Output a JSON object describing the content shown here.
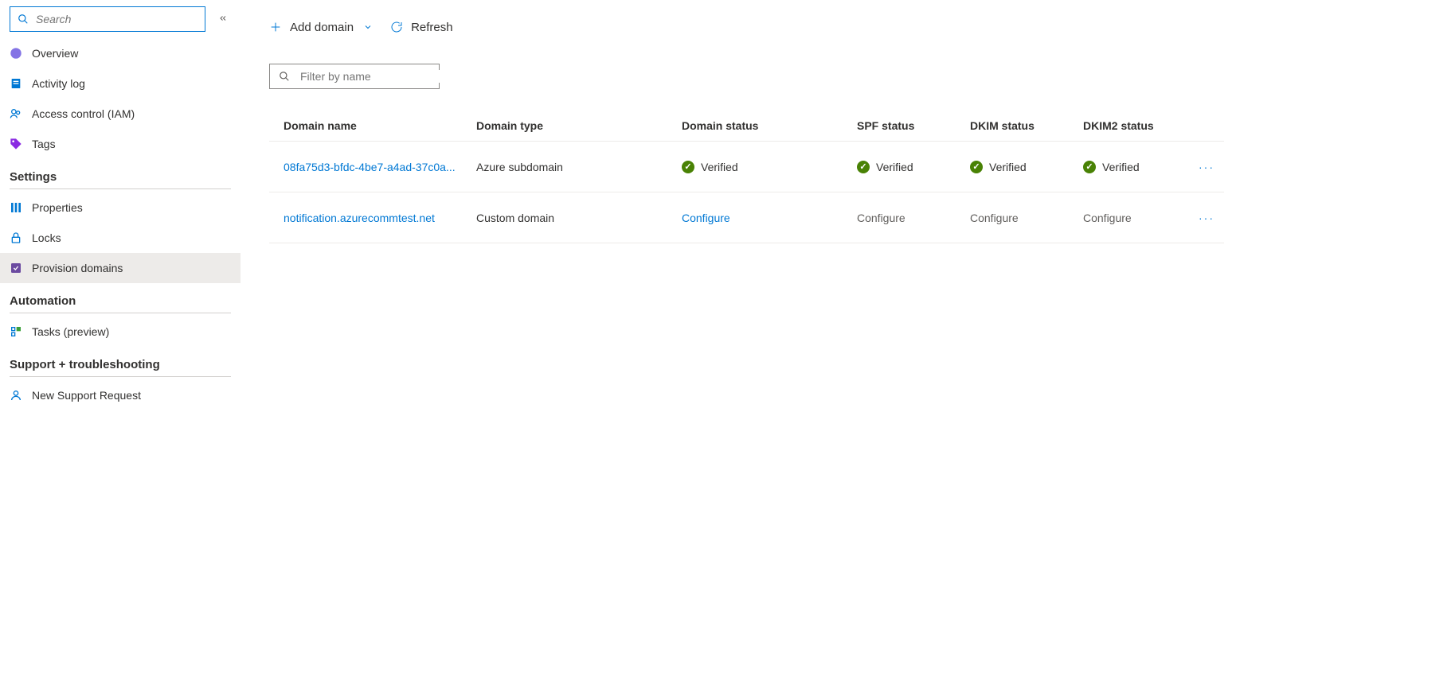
{
  "sidebar": {
    "search_placeholder": "Search",
    "items_top": [
      {
        "label": "Overview",
        "icon": "overview"
      },
      {
        "label": "Activity log",
        "icon": "activity"
      },
      {
        "label": "Access control (IAM)",
        "icon": "iam"
      },
      {
        "label": "Tags",
        "icon": "tags"
      }
    ],
    "sections": [
      {
        "title": "Settings",
        "items": [
          {
            "label": "Properties",
            "icon": "properties"
          },
          {
            "label": "Locks",
            "icon": "locks"
          },
          {
            "label": "Provision domains",
            "icon": "provision",
            "selected": true
          }
        ]
      },
      {
        "title": "Automation",
        "items": [
          {
            "label": "Tasks (preview)",
            "icon": "tasks"
          }
        ]
      },
      {
        "title": "Support + troubleshooting",
        "items": [
          {
            "label": "New Support Request",
            "icon": "support"
          }
        ]
      }
    ]
  },
  "toolbar": {
    "add_label": "Add domain",
    "refresh_label": "Refresh"
  },
  "filter": {
    "placeholder": "Filter by name"
  },
  "table": {
    "headers": {
      "name": "Domain name",
      "type": "Domain type",
      "domain_status": "Domain status",
      "spf": "SPF status",
      "dkim": "DKIM status",
      "dkim2": "DKIM2 status"
    },
    "rows": [
      {
        "name": "08fa75d3-bfdc-4be7-a4ad-37c0a...",
        "type": "Azure subdomain",
        "domain_status": {
          "text": "Verified",
          "state": "verified"
        },
        "spf": {
          "text": "Verified",
          "state": "verified"
        },
        "dkim": {
          "text": "Verified",
          "state": "verified"
        },
        "dkim2": {
          "text": "Verified",
          "state": "verified"
        }
      },
      {
        "name": "notification.azurecommtest.net",
        "type": "Custom domain",
        "domain_status": {
          "text": "Configure",
          "state": "configure"
        },
        "spf": {
          "text": "Configure",
          "state": "none"
        },
        "dkim": {
          "text": "Configure",
          "state": "none"
        },
        "dkim2": {
          "text": "Configure",
          "state": "none"
        }
      }
    ]
  }
}
